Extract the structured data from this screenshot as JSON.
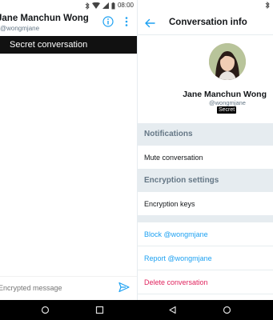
{
  "status_bar": {
    "time": "08:00"
  },
  "left": {
    "contact_name": "Jane Manchun Wong",
    "contact_handle": "@wongmjane",
    "secret_banner": "Secret conversation",
    "composer_placeholder": "Encrypted message"
  },
  "right": {
    "title": "Conversation info",
    "profile": {
      "name": "Jane Manchun Wong",
      "handle": "@wongmjane",
      "badge": "Secret"
    },
    "sections": {
      "notifications": "Notifications",
      "mute": "Mute conversation",
      "encryption_settings": "Encryption settings",
      "encryption_keys": "Encryption keys"
    },
    "actions": {
      "block": "Block @wongmjane",
      "report": "Report @wongmjane",
      "delete": "Delete conversation"
    }
  },
  "colors": {
    "accent": "#1da1f2",
    "danger": "#e0245e",
    "section_bg": "#e6ecf0",
    "banner_bg": "#111111"
  }
}
